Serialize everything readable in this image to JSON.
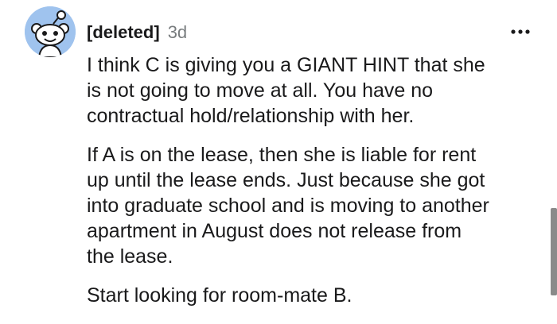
{
  "comment": {
    "author": "[deleted]",
    "age": "3d",
    "avatar_icon": "snoo-avatar-icon",
    "menu_icon": "more-options-icon",
    "paragraphs": [
      "I think C is giving you a GIANT HINT that she\nis not going to move at all. You have no\ncontractual hold/relationship with her.",
      "If A is on the lease, then she is liable for rent\nup until the lease ends. Just because she got\ninto graduate school and is moving to another\napartment in August does not release from\nthe lease.",
      "Start looking for room-mate B."
    ]
  },
  "colors": {
    "avatar_bg": "#9fc3ee",
    "text": "#1a1a1b",
    "muted": "#787c7e"
  }
}
